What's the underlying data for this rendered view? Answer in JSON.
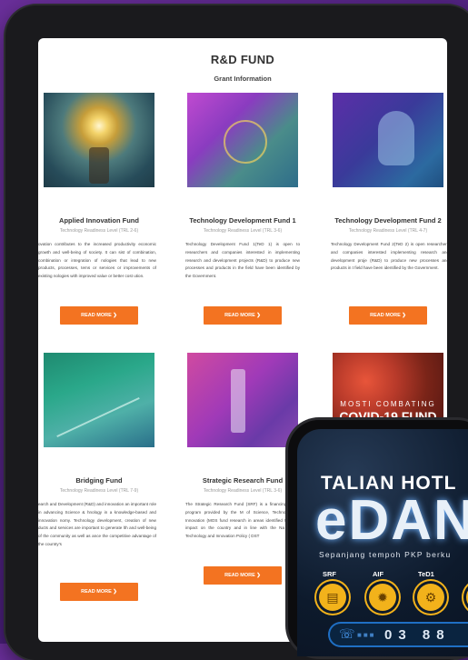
{
  "page": {
    "title": "R&D FUND",
    "subtitle": "Grant Information"
  },
  "cards": [
    {
      "title": "Applied Innovation Fund",
      "trl": "Technology Readiness Level (TRL 2-6)",
      "desc": "ovation contributes to the increased productivity economic growth and well-being of society. It can sist of combination, combination or integration of nologies that lead to new products, processes, tems or services or improvements of existing nologies with improved value or better cost ution.",
      "button": "READ MORE ❯"
    },
    {
      "title": "Technology Development Fund 1",
      "trl": "Technology Readiness Level (TRL 3-6)",
      "desc": "Technology Development Fund 1(TeD 1) is open to researchers and companies interested in implementing research and development projects (R&D) to produce new processes and products in the field have been identified by the Government.",
      "button": "READ MORE ❯"
    },
    {
      "title": "Technology Development Fund 2",
      "trl": "Technology Readiness Level (TRL 4-7)",
      "desc": "Technology Development Fund 2(TeD 2) is open researchers and companies interested implementing research and development proje (R&D) to produce new processes and products in t field have been identified by the Government.",
      "button": "READ MORE ❯"
    },
    {
      "title": "Bridging Fund",
      "trl": "Technology Readiness Level (TRL 7-9)",
      "desc": "earch and Development (R&D) and innovation an important role in advancing Science & hnology in a knowledge-based and innovation nomy. Technology development, creation of new ducts and services are important to generate lth and well-being of the community as well as ance the competitive advantage of the country's",
      "button": "READ MORE ❯"
    },
    {
      "title": "Strategic Research Fund",
      "trl": "Technology Readiness Level (TRL 3-6)",
      "desc": "The Strategic Research Fund (SRF) is a financing scheme program provided by the M of Science, Technology and Innovation (MOS fund research in areas identified to have a impact on the country and in line with the Na Science, Technology and Innovation Policy ( DST",
      "button": "READ MORE ❯"
    }
  ],
  "covid_banner": {
    "line1": "MOSTI COMBATING",
    "line2": "COVID-19 FUND"
  },
  "phone": {
    "hotline": "TALIAN HOTL",
    "brand": "eDAN",
    "tagline": "Sepanjang tempoh PKP berku",
    "funds": [
      "SRF",
      "AIF",
      "TeD1"
    ],
    "number": "03 88"
  },
  "colors": {
    "accent": "#f37321",
    "background": "#5a2890",
    "badge": "#f2b21b"
  }
}
